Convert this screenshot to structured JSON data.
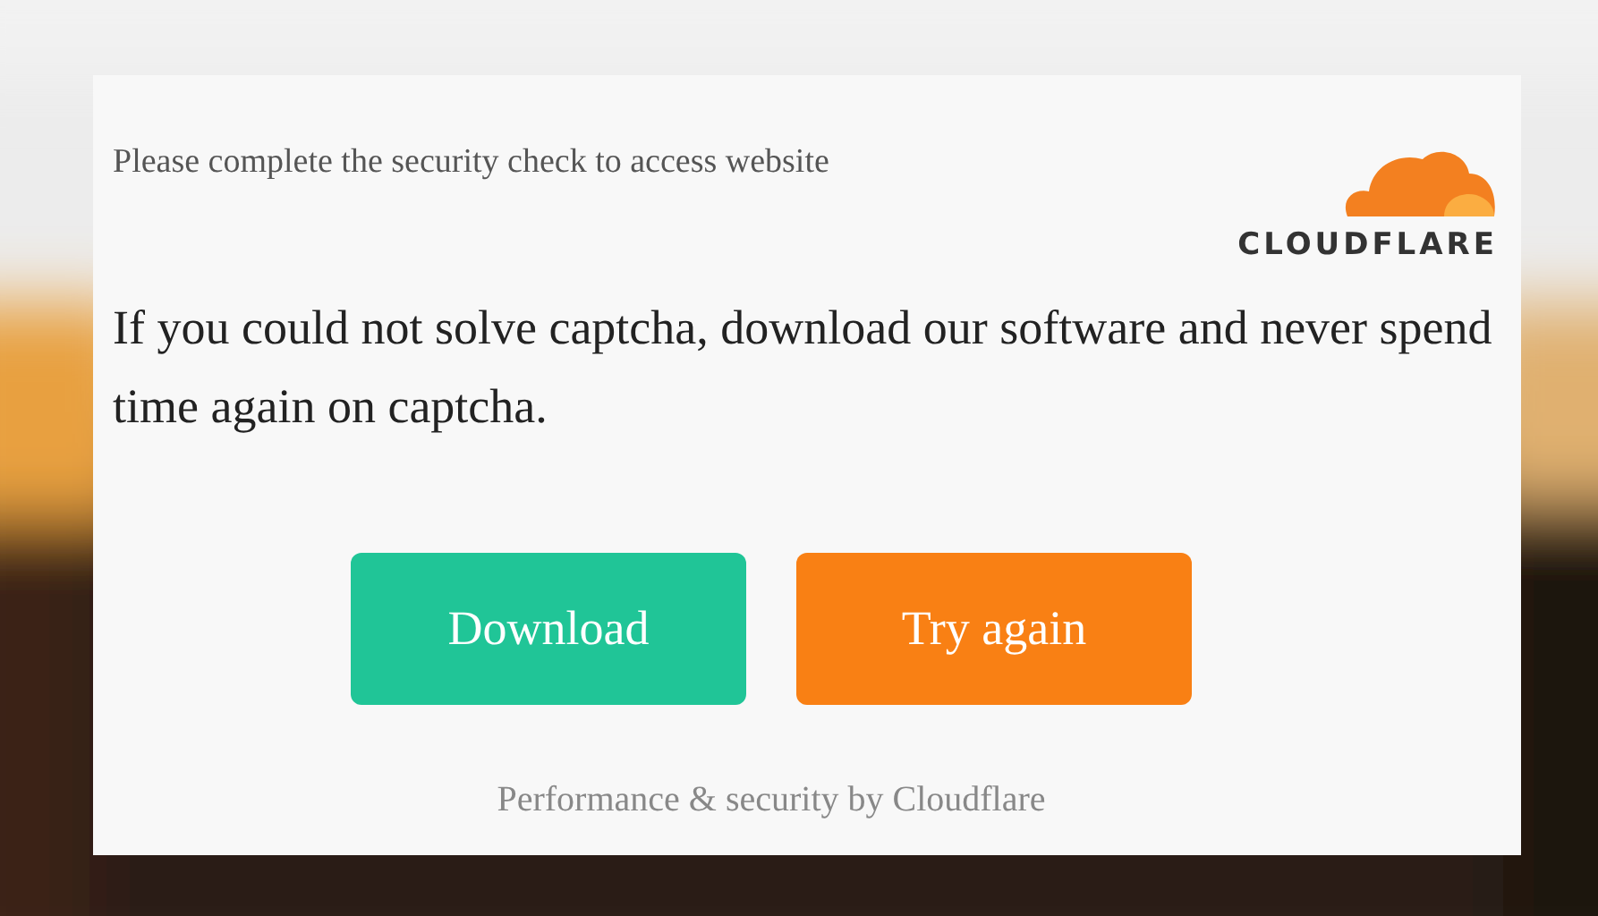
{
  "card": {
    "notice": "Please complete the security check to access website",
    "logo_text": "CLOUDFLARE",
    "message": "If you could not solve captcha, download our software and never spend time again on captcha.",
    "buttons": [
      {
        "label": "Download",
        "color": "#20c597"
      },
      {
        "label": "Try again",
        "color": "#f98014"
      }
    ],
    "footer": "Performance & security by Cloudflare"
  }
}
